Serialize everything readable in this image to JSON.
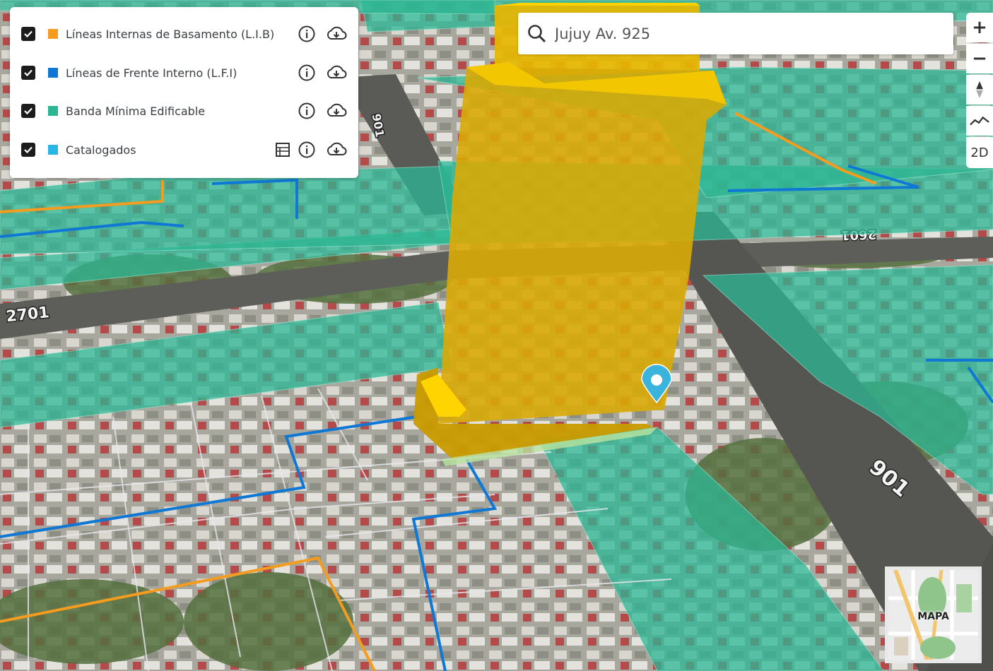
{
  "search": {
    "value": "Jujuy Av. 925"
  },
  "layers": [
    {
      "label": "Líneas Internas de Basamento (L.I.B)",
      "color": "#f39c1f",
      "checked": true,
      "has_table": false
    },
    {
      "label": "Líneas de Frente Interno (L.F.I)",
      "color": "#0f78d4",
      "checked": true,
      "has_table": false
    },
    {
      "label": "Banda Mínima Edificable",
      "color": "#2cb794",
      "checked": true,
      "has_table": false
    },
    {
      "label": "Catalogados",
      "color": "#27b6e6",
      "checked": true,
      "has_table": true
    }
  ],
  "map_controls": {
    "zoom_in": "+",
    "zoom_out": "−",
    "mode": "2D"
  },
  "minimap": {
    "label": "MAPA"
  },
  "street_labels": [
    "2701",
    "2601",
    "901",
    "901"
  ],
  "colors": {
    "banda": "#2cb794",
    "lib": "#f39c1f",
    "lfi": "#0f78d4",
    "building": "#e0b400",
    "marker": "#3ab4dc"
  }
}
